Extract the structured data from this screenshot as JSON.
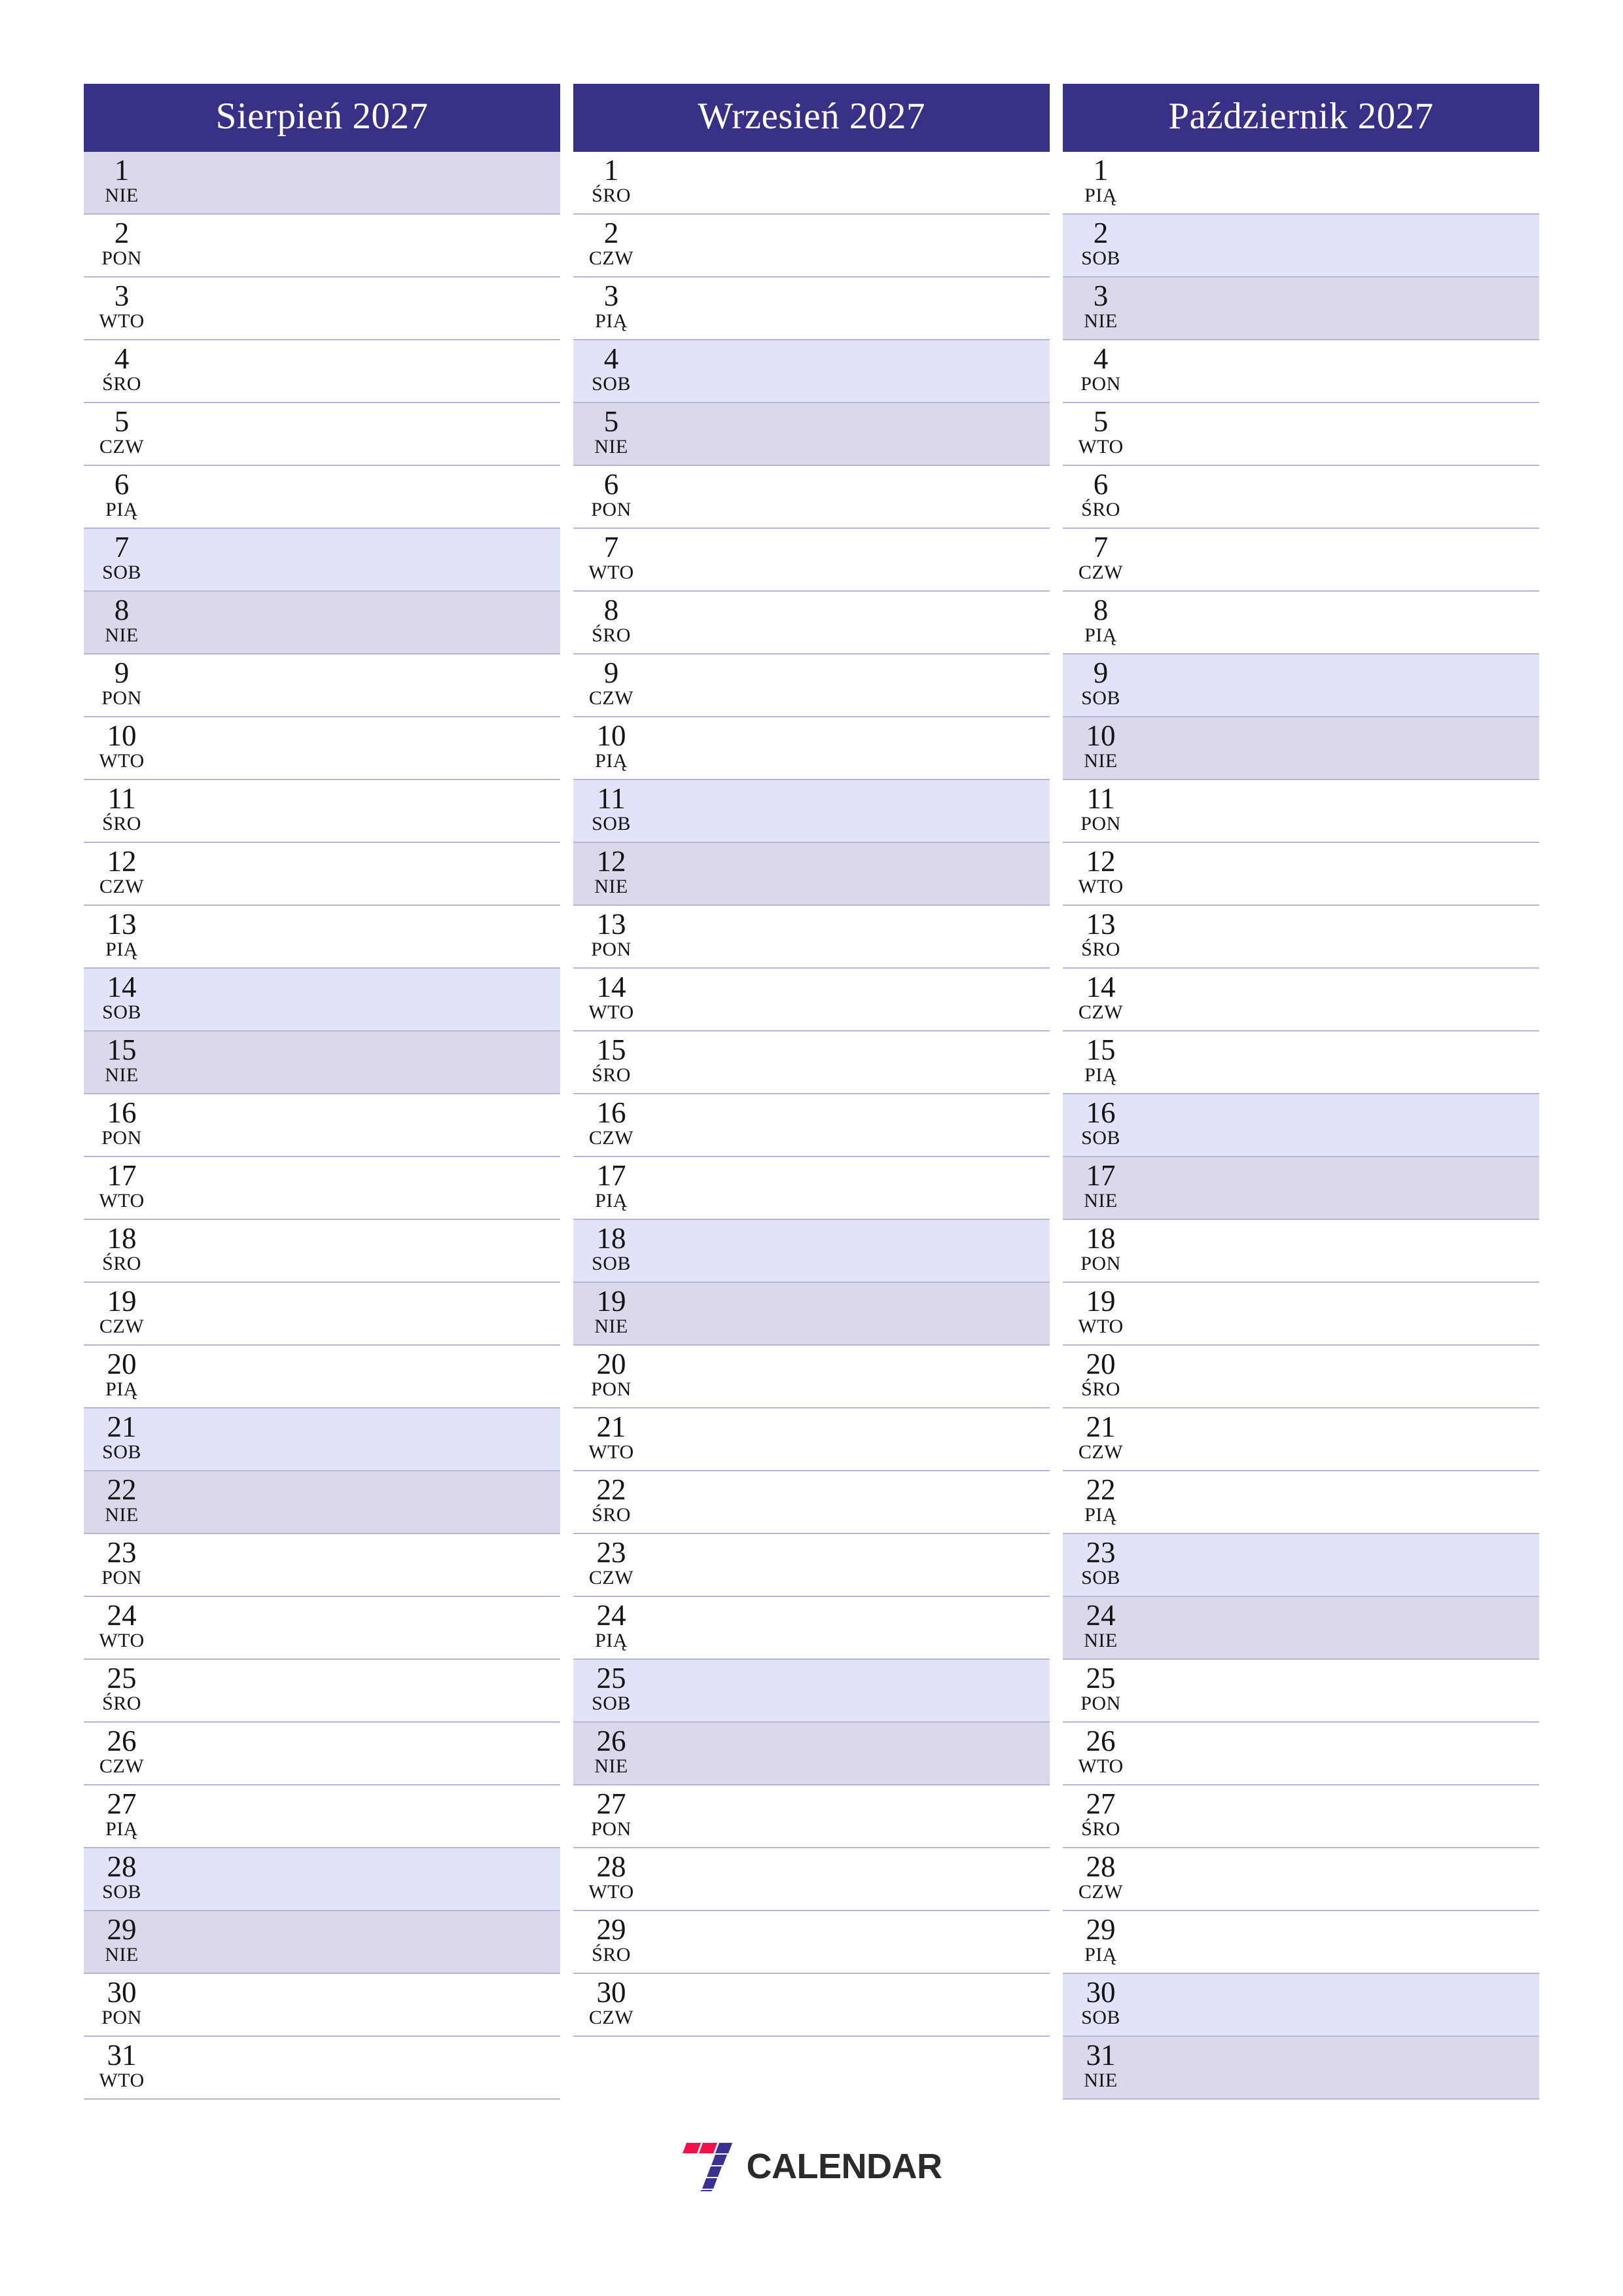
{
  "document": {
    "type": "three-month-planner",
    "year": "2027",
    "language": "pl"
  },
  "colors": {
    "header_bg": "#383086",
    "header_text": "#ffffff",
    "saturday_bg": "#e2e2f8",
    "sunday_bg": "#dbd8ec",
    "row_border": "#b8b6d8",
    "day_text": "#141414",
    "logo_red": "#f4104a",
    "logo_purple": "#3b3190",
    "logo_word": "#2b2b2b"
  },
  "brand": {
    "mark_icon": "seven-logo-icon",
    "word": "CALENDAR"
  },
  "months": [
    {
      "title": "Sierpień 2027",
      "name": "Sierpień",
      "year": "2027",
      "days": [
        {
          "num": "1",
          "abbr": "NIE",
          "kind": "sun"
        },
        {
          "num": "2",
          "abbr": "PON",
          "kind": "weekday"
        },
        {
          "num": "3",
          "abbr": "WTO",
          "kind": "weekday"
        },
        {
          "num": "4",
          "abbr": "ŚRO",
          "kind": "weekday"
        },
        {
          "num": "5",
          "abbr": "CZW",
          "kind": "weekday"
        },
        {
          "num": "6",
          "abbr": "PIĄ",
          "kind": "weekday"
        },
        {
          "num": "7",
          "abbr": "SOB",
          "kind": "sat"
        },
        {
          "num": "8",
          "abbr": "NIE",
          "kind": "sun"
        },
        {
          "num": "9",
          "abbr": "PON",
          "kind": "weekday"
        },
        {
          "num": "10",
          "abbr": "WTO",
          "kind": "weekday"
        },
        {
          "num": "11",
          "abbr": "ŚRO",
          "kind": "weekday"
        },
        {
          "num": "12",
          "abbr": "CZW",
          "kind": "weekday"
        },
        {
          "num": "13",
          "abbr": "PIĄ",
          "kind": "weekday"
        },
        {
          "num": "14",
          "abbr": "SOB",
          "kind": "sat"
        },
        {
          "num": "15",
          "abbr": "NIE",
          "kind": "sun"
        },
        {
          "num": "16",
          "abbr": "PON",
          "kind": "weekday"
        },
        {
          "num": "17",
          "abbr": "WTO",
          "kind": "weekday"
        },
        {
          "num": "18",
          "abbr": "ŚRO",
          "kind": "weekday"
        },
        {
          "num": "19",
          "abbr": "CZW",
          "kind": "weekday"
        },
        {
          "num": "20",
          "abbr": "PIĄ",
          "kind": "weekday"
        },
        {
          "num": "21",
          "abbr": "SOB",
          "kind": "sat"
        },
        {
          "num": "22",
          "abbr": "NIE",
          "kind": "sun"
        },
        {
          "num": "23",
          "abbr": "PON",
          "kind": "weekday"
        },
        {
          "num": "24",
          "abbr": "WTO",
          "kind": "weekday"
        },
        {
          "num": "25",
          "abbr": "ŚRO",
          "kind": "weekday"
        },
        {
          "num": "26",
          "abbr": "CZW",
          "kind": "weekday"
        },
        {
          "num": "27",
          "abbr": "PIĄ",
          "kind": "weekday"
        },
        {
          "num": "28",
          "abbr": "SOB",
          "kind": "sat"
        },
        {
          "num": "29",
          "abbr": "NIE",
          "kind": "sun"
        },
        {
          "num": "30",
          "abbr": "PON",
          "kind": "weekday"
        },
        {
          "num": "31",
          "abbr": "WTO",
          "kind": "weekday"
        }
      ]
    },
    {
      "title": "Wrzesień 2027",
      "name": "Wrzesień",
      "year": "2027",
      "days": [
        {
          "num": "1",
          "abbr": "ŚRO",
          "kind": "weekday"
        },
        {
          "num": "2",
          "abbr": "CZW",
          "kind": "weekday"
        },
        {
          "num": "3",
          "abbr": "PIĄ",
          "kind": "weekday"
        },
        {
          "num": "4",
          "abbr": "SOB",
          "kind": "sat"
        },
        {
          "num": "5",
          "abbr": "NIE",
          "kind": "sun"
        },
        {
          "num": "6",
          "abbr": "PON",
          "kind": "weekday"
        },
        {
          "num": "7",
          "abbr": "WTO",
          "kind": "weekday"
        },
        {
          "num": "8",
          "abbr": "ŚRO",
          "kind": "weekday"
        },
        {
          "num": "9",
          "abbr": "CZW",
          "kind": "weekday"
        },
        {
          "num": "10",
          "abbr": "PIĄ",
          "kind": "weekday"
        },
        {
          "num": "11",
          "abbr": "SOB",
          "kind": "sat"
        },
        {
          "num": "12",
          "abbr": "NIE",
          "kind": "sun"
        },
        {
          "num": "13",
          "abbr": "PON",
          "kind": "weekday"
        },
        {
          "num": "14",
          "abbr": "WTO",
          "kind": "weekday"
        },
        {
          "num": "15",
          "abbr": "ŚRO",
          "kind": "weekday"
        },
        {
          "num": "16",
          "abbr": "CZW",
          "kind": "weekday"
        },
        {
          "num": "17",
          "abbr": "PIĄ",
          "kind": "weekday"
        },
        {
          "num": "18",
          "abbr": "SOB",
          "kind": "sat"
        },
        {
          "num": "19",
          "abbr": "NIE",
          "kind": "sun"
        },
        {
          "num": "20",
          "abbr": "PON",
          "kind": "weekday"
        },
        {
          "num": "21",
          "abbr": "WTO",
          "kind": "weekday"
        },
        {
          "num": "22",
          "abbr": "ŚRO",
          "kind": "weekday"
        },
        {
          "num": "23",
          "abbr": "CZW",
          "kind": "weekday"
        },
        {
          "num": "24",
          "abbr": "PIĄ",
          "kind": "weekday"
        },
        {
          "num": "25",
          "abbr": "SOB",
          "kind": "sat"
        },
        {
          "num": "26",
          "abbr": "NIE",
          "kind": "sun"
        },
        {
          "num": "27",
          "abbr": "PON",
          "kind": "weekday"
        },
        {
          "num": "28",
          "abbr": "WTO",
          "kind": "weekday"
        },
        {
          "num": "29",
          "abbr": "ŚRO",
          "kind": "weekday"
        },
        {
          "num": "30",
          "abbr": "CZW",
          "kind": "weekday"
        }
      ]
    },
    {
      "title": "Październik 2027",
      "name": "Październik",
      "year": "2027",
      "days": [
        {
          "num": "1",
          "abbr": "PIĄ",
          "kind": "weekday"
        },
        {
          "num": "2",
          "abbr": "SOB",
          "kind": "sat"
        },
        {
          "num": "3",
          "abbr": "NIE",
          "kind": "sun"
        },
        {
          "num": "4",
          "abbr": "PON",
          "kind": "weekday"
        },
        {
          "num": "5",
          "abbr": "WTO",
          "kind": "weekday"
        },
        {
          "num": "6",
          "abbr": "ŚRO",
          "kind": "weekday"
        },
        {
          "num": "7",
          "abbr": "CZW",
          "kind": "weekday"
        },
        {
          "num": "8",
          "abbr": "PIĄ",
          "kind": "weekday"
        },
        {
          "num": "9",
          "abbr": "SOB",
          "kind": "sat"
        },
        {
          "num": "10",
          "abbr": "NIE",
          "kind": "sun"
        },
        {
          "num": "11",
          "abbr": "PON",
          "kind": "weekday"
        },
        {
          "num": "12",
          "abbr": "WTO",
          "kind": "weekday"
        },
        {
          "num": "13",
          "abbr": "ŚRO",
          "kind": "weekday"
        },
        {
          "num": "14",
          "abbr": "CZW",
          "kind": "weekday"
        },
        {
          "num": "15",
          "abbr": "PIĄ",
          "kind": "weekday"
        },
        {
          "num": "16",
          "abbr": "SOB",
          "kind": "sat"
        },
        {
          "num": "17",
          "abbr": "NIE",
          "kind": "sun"
        },
        {
          "num": "18",
          "abbr": "PON",
          "kind": "weekday"
        },
        {
          "num": "19",
          "abbr": "WTO",
          "kind": "weekday"
        },
        {
          "num": "20",
          "abbr": "ŚRO",
          "kind": "weekday"
        },
        {
          "num": "21",
          "abbr": "CZW",
          "kind": "weekday"
        },
        {
          "num": "22",
          "abbr": "PIĄ",
          "kind": "weekday"
        },
        {
          "num": "23",
          "abbr": "SOB",
          "kind": "sat"
        },
        {
          "num": "24",
          "abbr": "NIE",
          "kind": "sun"
        },
        {
          "num": "25",
          "abbr": "PON",
          "kind": "weekday"
        },
        {
          "num": "26",
          "abbr": "WTO",
          "kind": "weekday"
        },
        {
          "num": "27",
          "abbr": "ŚRO",
          "kind": "weekday"
        },
        {
          "num": "28",
          "abbr": "CZW",
          "kind": "weekday"
        },
        {
          "num": "29",
          "abbr": "PIĄ",
          "kind": "weekday"
        },
        {
          "num": "30",
          "abbr": "SOB",
          "kind": "sat"
        },
        {
          "num": "31",
          "abbr": "NIE",
          "kind": "sun"
        }
      ]
    }
  ]
}
